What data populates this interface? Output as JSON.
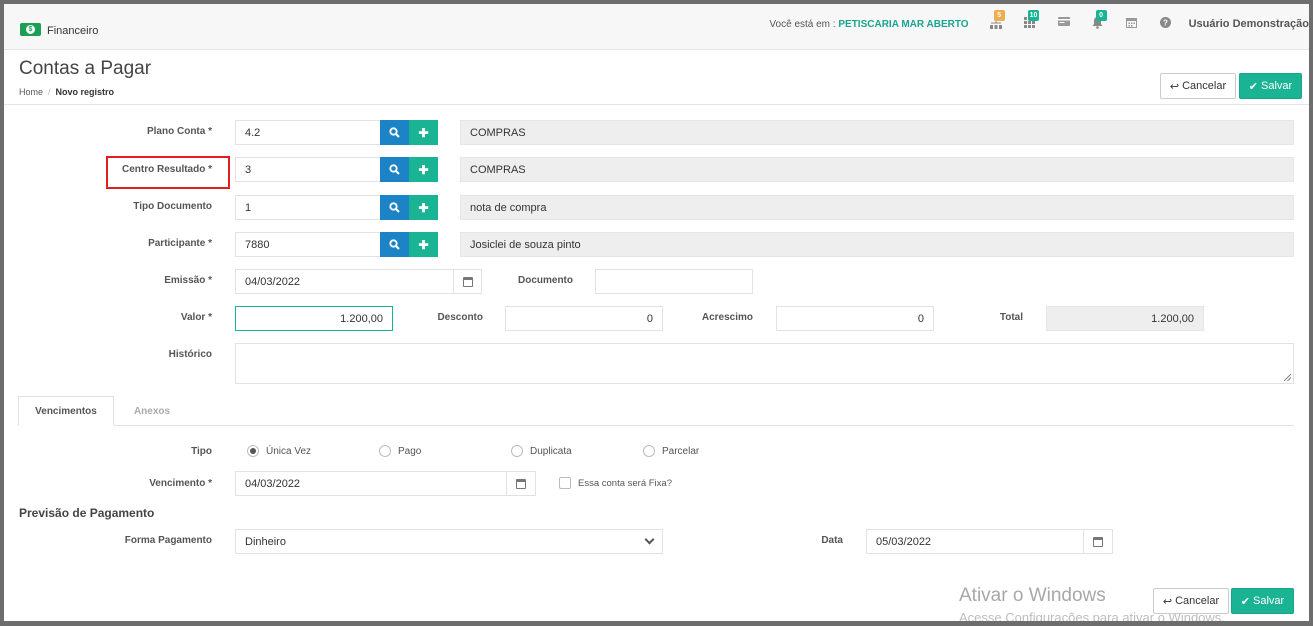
{
  "topbar": {
    "app_name": "Financeiro",
    "location_prefix": "Você está em :",
    "location_name": "PETISCARIA MAR ABERTO",
    "badges": {
      "org": "5",
      "grid": "10",
      "bell": "0"
    },
    "user": "Usuário Demonstração"
  },
  "page": {
    "title": "Contas a Pagar",
    "breadcrumb_home": "Home",
    "breadcrumb_sep": "/",
    "breadcrumb_current": "Novo registro"
  },
  "actions": {
    "cancel": "Cancelar",
    "save": "Salvar"
  },
  "form": {
    "plano_conta": {
      "label": "Plano Conta *",
      "value": "4.2",
      "desc": "COMPRAS"
    },
    "centro_resultado": {
      "label": "Centro Resultado *",
      "value": "3",
      "desc": "COMPRAS"
    },
    "tipo_documento": {
      "label": "Tipo Documento",
      "value": "1",
      "desc": "nota de compra"
    },
    "participante": {
      "label": "Participante *",
      "value": "7880",
      "desc": "Josiclei de souza pinto"
    },
    "emissao": {
      "label": "Emissão *",
      "value": "04/03/2022"
    },
    "documento": {
      "label": "Documento",
      "value": ""
    },
    "valor": {
      "label": "Valor *",
      "value": "1.200,00"
    },
    "desconto": {
      "label": "Desconto",
      "value": "0"
    },
    "acrescimo": {
      "label": "Acrescimo",
      "value": "0"
    },
    "total": {
      "label": "Total",
      "value": "1.200,00"
    },
    "historico": {
      "label": "Histórico",
      "value": ""
    }
  },
  "tabs": {
    "vencimentos": "Vencimentos",
    "anexos": "Anexos"
  },
  "vencimentos": {
    "tipo_label": "Tipo",
    "options": {
      "unica": "Única Vez",
      "pago": "Pago",
      "duplicata": "Duplicata",
      "parcelar": "Parcelar"
    },
    "selected": "Única Vez",
    "vencimento_label": "Vencimento *",
    "vencimento_value": "04/03/2022",
    "fixa_label": "Essa conta será Fixa?"
  },
  "previsao": {
    "title": "Previsão de Pagamento",
    "forma_label": "Forma Pagamento",
    "forma_value": "Dinheiro",
    "data_label": "Data",
    "data_value": "05/03/2022"
  },
  "watermark": {
    "line1": "Ativar o Windows",
    "line2": "Acesse Configurações para ativar o Windows."
  },
  "colors": {
    "accent": "#1ab394",
    "blue": "#1c84c6",
    "highlight": "#e02020"
  }
}
